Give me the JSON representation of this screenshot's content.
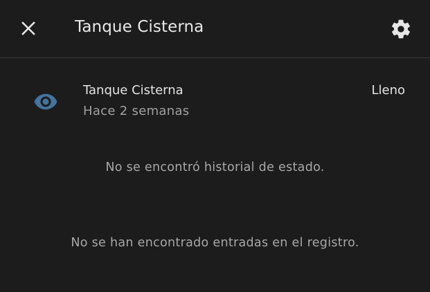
{
  "header": {
    "close_icon": "close-icon",
    "title": "Tanque Cisterna",
    "settings_icon": "gear-icon"
  },
  "entity": {
    "icon": "eye-icon",
    "icon_color": "#44739e",
    "name": "Tanque Cisterna",
    "last_changed": "Hace 2 semanas",
    "state": "Lleno"
  },
  "history": {
    "empty_message": "No se encontró historial de estado."
  },
  "logbook": {
    "empty_message": "No se han encontrado entradas en el registro."
  }
}
